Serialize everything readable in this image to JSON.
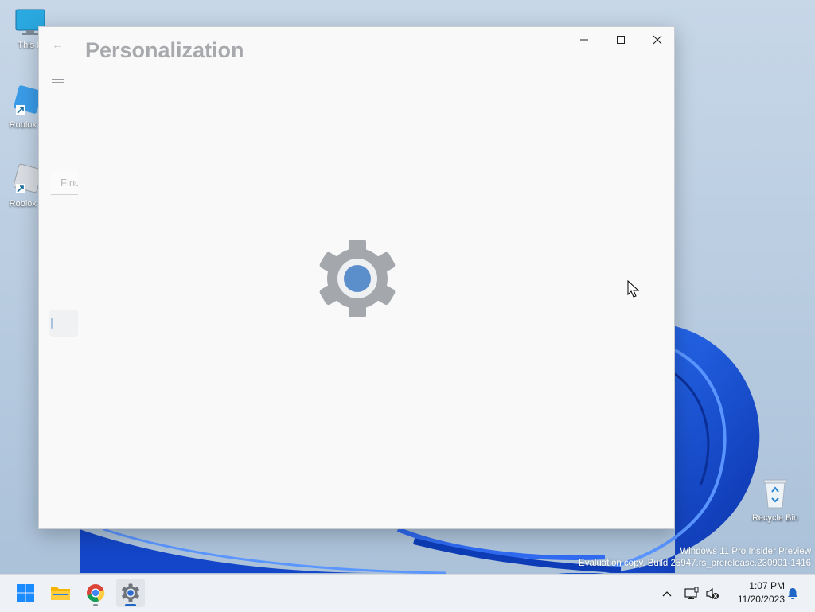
{
  "desktop": {
    "icons": [
      {
        "label": "This P"
      },
      {
        "label": "Roblox S"
      },
      {
        "label": "Roblox P"
      },
      {
        "label": "Recycle Bin"
      }
    ],
    "watermark": {
      "line1": "Windows 11 Pro Insider Preview",
      "line2": "Evaluation copy. Build 25947.rs_prerelease.230901-1416"
    }
  },
  "window": {
    "title": "Personalization",
    "search_text": "Finc",
    "controls": [
      "minimize-icon",
      "maximize-icon",
      "close-icon"
    ],
    "splash_icon": "settings-gear-icon"
  },
  "taskbar": {
    "apps": [
      {
        "name": "Start",
        "icon": "windows-logo-icon"
      },
      {
        "name": "File Explorer",
        "icon": "folder-icon"
      },
      {
        "name": "Google Chrome",
        "icon": "chrome-icon"
      },
      {
        "name": "Settings",
        "icon": "gear-icon",
        "active": true
      }
    ],
    "tray": {
      "time": "1:07 PM",
      "date": "11/20/2023"
    }
  },
  "colors": {
    "accent": "#1f66c6",
    "wallpaper_blue": "#0f4fcf",
    "window_bg": "#f9f9fa"
  }
}
